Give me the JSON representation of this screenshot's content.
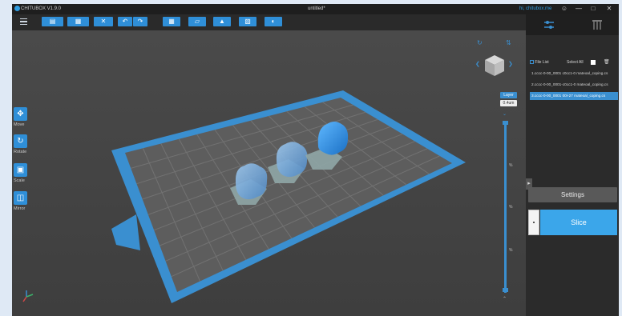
{
  "titlebar": {
    "app_title": "CHITUBOX V1.9.0",
    "doc_title": "untitled*",
    "user": "hi, chitubox.me",
    "icons": [
      "user-icon",
      "minimize-icon",
      "maximize-icon",
      "close-icon"
    ]
  },
  "toolbar": {
    "buttons": [
      {
        "name": "open-file-button",
        "icon": "folder-icon"
      },
      {
        "name": "save-button",
        "icon": "save-icon"
      },
      {
        "name": "delete-button",
        "icon": "close-icon"
      },
      {
        "name": "undo-button",
        "icon": "undo-icon"
      },
      {
        "name": "redo-button",
        "icon": "redo-icon"
      },
      {
        "name": "layout-button",
        "icon": "grid-icon"
      },
      {
        "name": "hollow-button",
        "icon": "hollow-icon"
      },
      {
        "name": "support-button",
        "icon": "support-icon"
      },
      {
        "name": "split-button",
        "icon": "split-icon"
      },
      {
        "name": "measure-button",
        "icon": "measure-icon"
      }
    ]
  },
  "left_tools": [
    {
      "label": "Move",
      "icon": "move-icon"
    },
    {
      "label": "Rotate",
      "icon": "rotate-icon"
    },
    {
      "label": "Scale",
      "icon": "scale-icon"
    },
    {
      "label": "Mirror",
      "icon": "mirror-icon"
    }
  ],
  "layer_slider": {
    "top_badge": "Layer",
    "second_badge": "0.4um",
    "marks": [
      "%",
      "%",
      "%"
    ]
  },
  "panel": {
    "file_list_label": "File List",
    "select_all_label": "Select All",
    "files": [
      "1.cccc-0-00_0001 c0cc1-0 mateoal_coping.cs",
      "2.cccc-0-00_0001-c0cc1-0 mateoal_coping.cs",
      "3.cccc-0-00_0001 00I-27 mateoal_coping.cs"
    ],
    "selected_index": 2,
    "settings_label": "Settings",
    "slice_label": "Slice"
  },
  "colors": {
    "accent": "#2f8fd8",
    "plate": "#5a5a5a",
    "border": "#3a8fd0"
  }
}
